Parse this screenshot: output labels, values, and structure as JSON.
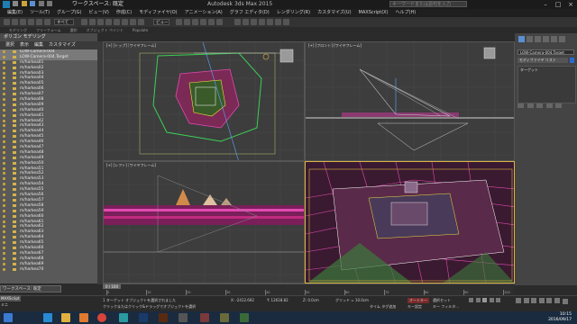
{
  "window": {
    "workspace_label": "ワークスペース: 既定",
    "title": "Autodesk 3ds Max 2015   ",
    "search_placeholder": "キーワードまたは語句を入力"
  },
  "menu": [
    "編集(E)",
    "ツール(T)",
    "グループ(G)",
    "ビュー(V)",
    "作成(C)",
    "モディファイヤ(O)",
    "アニメーション(A)",
    "グラフ エディタ(D)",
    "レンダリング(R)",
    "カスタマイズ(U)",
    "MAXScript(X)",
    "ヘルプ(H)"
  ],
  "toolbar": {
    "selection_filter": "すべて",
    "view_dropdown": "ビュー"
  },
  "ribbon": {
    "tabs": [
      "モデリング",
      "フリーフォーム",
      "選択",
      "オブジェクト ペイント",
      "Populate"
    ],
    "current": "ポリゴン モデリング"
  },
  "scene_explorer": {
    "tabs": [
      "選択",
      "表示",
      "編集",
      "カスタマイズ"
    ],
    "items": [
      {
        "name": "LOW-Camera-004",
        "selected": true
      },
      {
        "name": "LOW-Camera-004.Target",
        "selected": true
      },
      {
        "name": "m/harkea01"
      },
      {
        "name": "m/harkea02"
      },
      {
        "name": "m/harkea03"
      },
      {
        "name": "m/harkea04"
      },
      {
        "name": "m/harkea05"
      },
      {
        "name": "m/harkea06"
      },
      {
        "name": "m/harkea07"
      },
      {
        "name": "m/harkea08"
      },
      {
        "name": "m/harkea09"
      },
      {
        "name": "m/harkea40"
      },
      {
        "name": "m/harkea41"
      },
      {
        "name": "m/harkea42"
      },
      {
        "name": "m/harkea43"
      },
      {
        "name": "m/harkea44"
      },
      {
        "name": "m/harkea45"
      },
      {
        "name": "m/harkea46"
      },
      {
        "name": "m/harkea47"
      },
      {
        "name": "m/harkea48"
      },
      {
        "name": "m/harkea49"
      },
      {
        "name": "m/harkea50"
      },
      {
        "name": "m/harkea51"
      },
      {
        "name": "m/harkea52"
      },
      {
        "name": "m/harkea53"
      },
      {
        "name": "m/harkea54"
      },
      {
        "name": "m/harkea55"
      },
      {
        "name": "m/harkea56"
      },
      {
        "name": "m/harkea57"
      },
      {
        "name": "m/harkea58"
      },
      {
        "name": "m/harkea59"
      },
      {
        "name": "m/harkea60"
      },
      {
        "name": "m/harkea61"
      },
      {
        "name": "m/harkea62"
      },
      {
        "name": "m/harkea63"
      },
      {
        "name": "m/harkea64"
      },
      {
        "name": "m/harkea65"
      },
      {
        "name": "m/harkea66"
      },
      {
        "name": "m/harkea67"
      },
      {
        "name": "m/harkea68"
      },
      {
        "name": "m/harkea69"
      },
      {
        "name": "m/harkea70"
      }
    ],
    "workspace_box": "ワークスペース: 既定"
  },
  "viewports": {
    "top": "[+] [トップ] [ワイヤフレーム]",
    "front": "[+] [フロント] [ワイヤフレーム]",
    "left": "[+] [レフト] [ワイヤフレーム]",
    "camera": "[+] [LOW-Camera-004] [エッジ面付き]"
  },
  "command_panel": {
    "object_name": "LOW-Camera-004.Target",
    "modifier_list": "モディファイヤ リスト",
    "stack_item": "ターゲット"
  },
  "timeline": {
    "frame": "0 / 100",
    "ticks": [
      "0",
      "10",
      "20",
      "30",
      "40",
      "50",
      "60",
      "70",
      "80",
      "90",
      "100"
    ]
  },
  "status": {
    "line1": "1 ターゲット オブジェクトを選択されました",
    "line2": "クリックまたはクリック&ドラッグでオブジェクトを選択",
    "maxscript": "MAXScript ミニ",
    "x": "X: -2412.692",
    "y": "Y: 12618.82",
    "z": "Z: 0.0cm",
    "grid": "グリッド = 10.0cm",
    "add_time_tag": "タイム タグ追加",
    "auto_key": "オートキー",
    "set_key": "キー設定",
    "selection_set": "選択セット",
    "key_filter": "キー フィルタ..."
  },
  "taskbar": {
    "time": "10:15",
    "date": "2016/09/17"
  },
  "colors": {
    "accent": "#d9b341",
    "viewport_bg": "#3d3d3d",
    "taskbar": "#1a2b3f"
  }
}
